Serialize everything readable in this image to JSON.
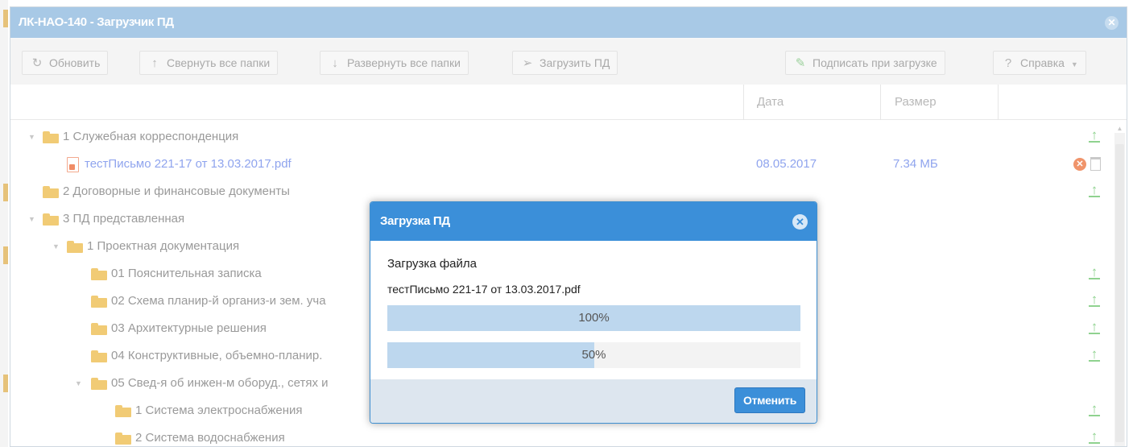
{
  "window": {
    "title": "ЛК-НАО-140 - Загрузчик ПД"
  },
  "toolbar": {
    "refresh_label": "Обновить",
    "collapse_label": "Свернуть все папки",
    "expand_label": "Развернуть все папки",
    "upload_label": "Загрузить ПД",
    "sign_label": "Подписать при загрузке",
    "help_label": "Справка"
  },
  "grid": {
    "columns": {
      "date": "Дата",
      "size": "Размер"
    },
    "rows": [
      {
        "label": "1 Служебная корреспонденция"
      },
      {
        "label": "тестПисьмо 221-17 от 13.03.2017.pdf",
        "date": "08.05.2017",
        "size": "7.34 МБ"
      },
      {
        "label": "2 Договорные и финансовые документы"
      },
      {
        "label": "3 ПД представленная"
      },
      {
        "label": "1 Проектная документация"
      },
      {
        "label": "01 Пояснительная записка"
      },
      {
        "label": "02 Схема планир-й организ-и зем. уча"
      },
      {
        "label": "03 Архитектурные решения"
      },
      {
        "label": "04 Конструктивные, объемно-планир."
      },
      {
        "label": "05 Свед-я об инжен-м оборуд., сетях и"
      },
      {
        "label": "1 Система электроснабжения"
      },
      {
        "label": "2 Система водоснабжения"
      }
    ]
  },
  "dialog": {
    "title": "Загрузка ПД",
    "heading": "Загрузка файла",
    "filename": "тестПисьмо 221-17 от 13.03.2017.pdf",
    "progress": [
      {
        "label": "100%",
        "value": 100
      },
      {
        "label": "50%",
        "value": 50
      }
    ],
    "cancel_label": "Отменить"
  },
  "colors": {
    "accent": "#3b8fd9",
    "title_bar": "#a8c9e6",
    "folder": "#f1cb75",
    "upload_icon": "#8fd28f",
    "file_link": "#8fa4ee"
  },
  "icons": {
    "refresh": "refresh-icon",
    "collapse": "arrow-up-icon",
    "expand": "arrow-down-icon",
    "upload": "paper-plane-icon",
    "sign": "pencil-icon",
    "help": "question-circle-icon",
    "row_upload": "upload-icon",
    "close": "close-icon"
  }
}
